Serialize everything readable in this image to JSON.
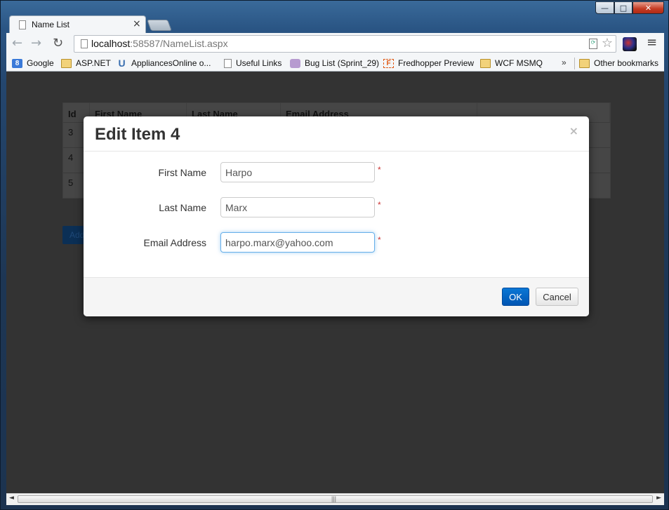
{
  "browser": {
    "tab_title": "Name List",
    "tab_close": "×",
    "url_host": "localhost",
    "url_rest": ":58587/NameList.aspx",
    "min": "—",
    "max": "□",
    "close": "✕",
    "back": "←",
    "forward": "→",
    "reload": "↻",
    "star": "☆",
    "menu": "≡"
  },
  "bookmarks": {
    "items": [
      {
        "label": "Google",
        "icon": "google-icon"
      },
      {
        "label": "ASP.NET",
        "icon": "folder-icon"
      },
      {
        "label": "AppliancesOnline o...",
        "icon": "u-icon"
      },
      {
        "label": "Useful Links",
        "icon": "page-icon"
      },
      {
        "label": "Bug List (Sprint_29)",
        "icon": "bug-icon"
      },
      {
        "label": "Fredhopper Preview",
        "icon": "f-icon"
      },
      {
        "label": "WCF MSMQ",
        "icon": "folder-icon"
      }
    ],
    "overflow": "»",
    "other": "Other bookmarks"
  },
  "table": {
    "headers": [
      "Id",
      "First Name",
      "Last Name",
      "Email Address",
      ""
    ],
    "rows": [
      [
        "3"
      ],
      [
        "4"
      ],
      [
        "5"
      ]
    ]
  },
  "add_button": "Add",
  "modal": {
    "title": "Edit Item 4",
    "close": "×",
    "fields": [
      {
        "label": "First Name",
        "value": "Harpo"
      },
      {
        "label": "Last Name",
        "value": "Marx"
      },
      {
        "label": "Email Address",
        "value": "harpo.marx@yahoo.com"
      }
    ],
    "required_marker": "*",
    "ok": "OK",
    "cancel": "Cancel"
  },
  "scrollbar": {
    "left": "◄",
    "right": "►",
    "grip": "|||"
  }
}
